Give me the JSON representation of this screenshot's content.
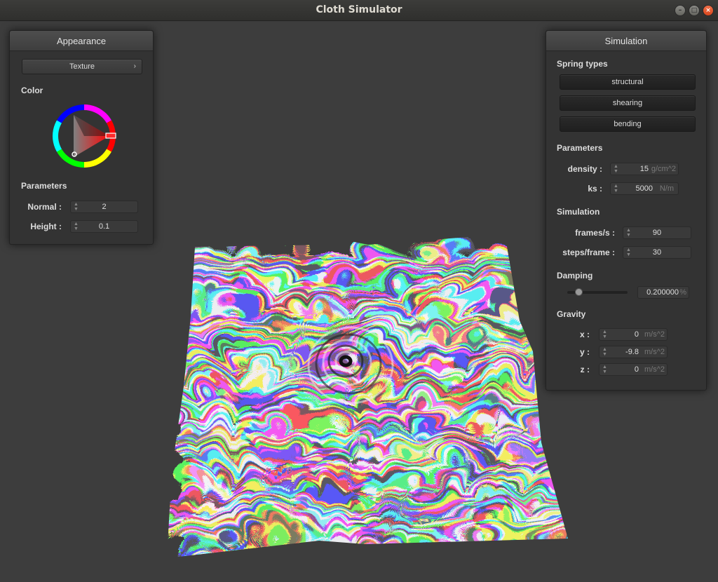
{
  "window": {
    "title": "Cloth Simulator"
  },
  "appearance": {
    "title": "Appearance",
    "texture_button": "Texture",
    "color_label": "Color",
    "parameters_label": "Parameters",
    "normal_label": "Normal :",
    "normal_value": "2",
    "height_label": "Height :",
    "height_value": "0.1",
    "selected_color": "#ff0000"
  },
  "simulation_panel": {
    "title": "Simulation",
    "spring_types_label": "Spring types",
    "spring_types": [
      "structural",
      "shearing",
      "bending"
    ],
    "parameters_label": "Parameters",
    "density_label": "density :",
    "density_value": "15",
    "density_unit": "g/cm^2",
    "ks_label": "ks :",
    "ks_value": "5000",
    "ks_unit": "N/m",
    "simulation_label": "Simulation",
    "fps_label": "frames/s :",
    "fps_value": "90",
    "steps_label": "steps/frame :",
    "steps_value": "30",
    "damping_label": "Damping",
    "damping_value": "0.200000",
    "damping_unit": "%",
    "damping_fraction": 0.2,
    "gravity_label": "Gravity",
    "gx_label": "x :",
    "gx_value": "0",
    "gy_label": "y :",
    "gy_value": "-9.8",
    "gz_label": "z :",
    "gz_value": "0",
    "gravity_unit": "m/s^2"
  }
}
